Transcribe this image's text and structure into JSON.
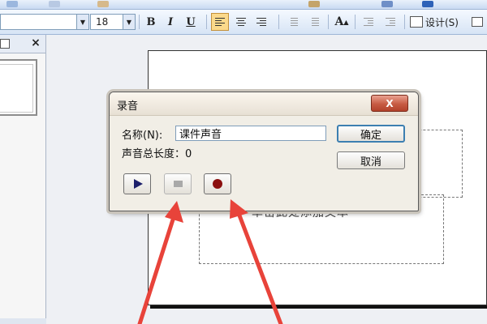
{
  "toolbar": {
    "font_size": "18",
    "bold_label": "B",
    "italic_label": "I",
    "underline_label": "U",
    "increase_font_label": "A",
    "design_label": "设计(S)"
  },
  "slide_panel": {
    "close_label": "×"
  },
  "slide": {
    "body_text": "单击此处添加文本"
  },
  "dialog": {
    "title": "录音",
    "close_label": "X",
    "name_label": "名称(N):",
    "name_value": "课件声音",
    "length_label": "声音总长度：",
    "length_value": "0",
    "ok_label": "确定",
    "cancel_label": "取消"
  },
  "colors": {
    "annotation_arrow": "#e8433a",
    "record_dot": "#8b0f0f",
    "play_triangle": "#1c1f6b"
  },
  "icons": [
    "play-icon",
    "stop-icon",
    "record-icon",
    "close-icon",
    "design-icon"
  ]
}
